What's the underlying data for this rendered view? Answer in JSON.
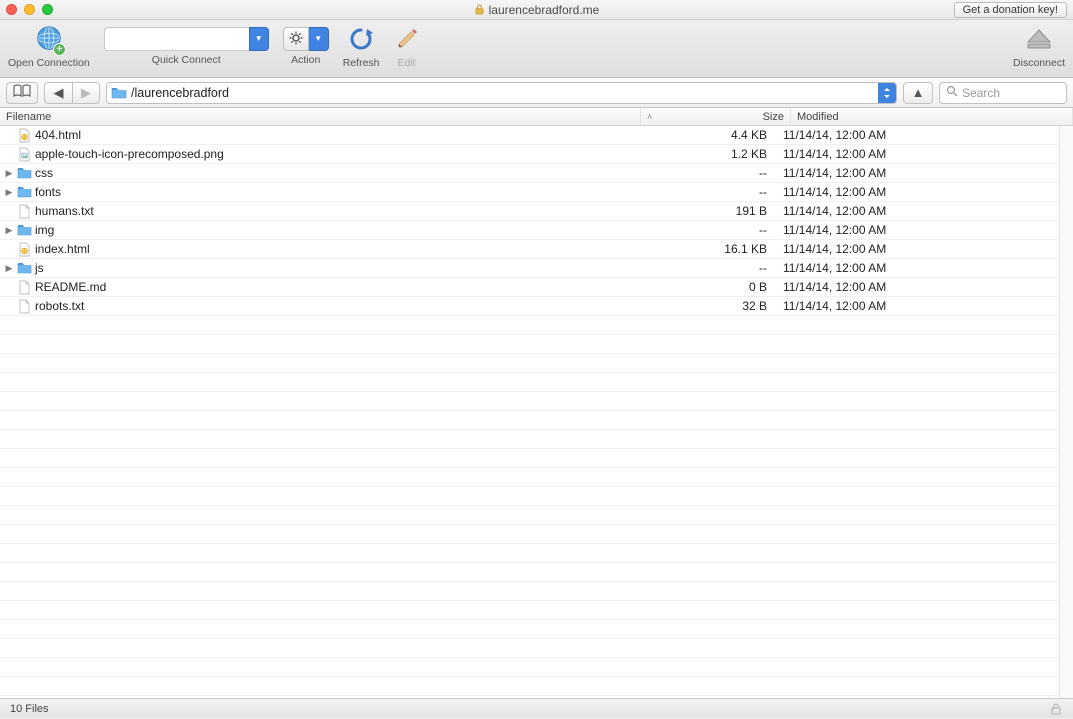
{
  "window": {
    "title": "laurencebradford.me",
    "donation_button": "Get a donation key!"
  },
  "toolbar": {
    "open_connection": "Open Connection",
    "quick_connect": "Quick Connect",
    "action": "Action",
    "refresh": "Refresh",
    "edit": "Edit",
    "disconnect": "Disconnect",
    "quick_connect_value": ""
  },
  "pathbar": {
    "path": "/laurencebradford",
    "search_placeholder": "Search"
  },
  "columns": {
    "filename": "Filename",
    "size": "Size",
    "modified": "Modified"
  },
  "files": [
    {
      "name": "404.html",
      "size": "4.4 KB",
      "modified": "11/14/14, 12:00 AM",
      "type": "html",
      "expandable": false
    },
    {
      "name": "apple-touch-icon-precomposed.png",
      "size": "1.2 KB",
      "modified": "11/14/14, 12:00 AM",
      "type": "image",
      "expandable": false
    },
    {
      "name": "css",
      "size": "--",
      "modified": "11/14/14, 12:00 AM",
      "type": "folder",
      "expandable": true
    },
    {
      "name": "fonts",
      "size": "--",
      "modified": "11/14/14, 12:00 AM",
      "type": "folder",
      "expandable": true
    },
    {
      "name": "humans.txt",
      "size": "191 B",
      "modified": "11/14/14, 12:00 AM",
      "type": "file",
      "expandable": false
    },
    {
      "name": "img",
      "size": "--",
      "modified": "11/14/14, 12:00 AM",
      "type": "folder",
      "expandable": true
    },
    {
      "name": "index.html",
      "size": "16.1 KB",
      "modified": "11/14/14, 12:00 AM",
      "type": "html",
      "expandable": false
    },
    {
      "name": "js",
      "size": "--",
      "modified": "11/14/14, 12:00 AM",
      "type": "folder",
      "expandable": true
    },
    {
      "name": "README.md",
      "size": "0 B",
      "modified": "11/14/14, 12:00 AM",
      "type": "file",
      "expandable": false
    },
    {
      "name": "robots.txt",
      "size": "32 B",
      "modified": "11/14/14, 12:00 AM",
      "type": "file",
      "expandable": false
    }
  ],
  "status": {
    "file_count": "10 Files"
  }
}
